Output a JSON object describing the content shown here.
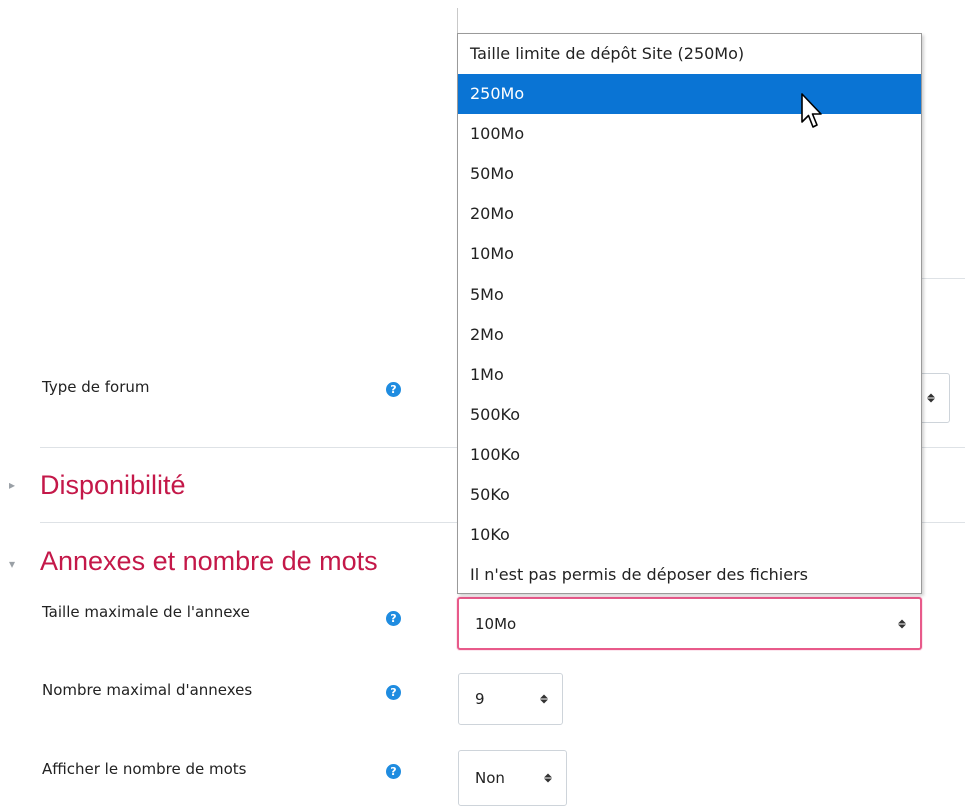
{
  "form": {
    "forum_type": {
      "label": "Type de forum"
    },
    "sections": {
      "disponibilite": "Disponibilité",
      "annexes": "Annexes et nombre de mots"
    },
    "max_attachment_size": {
      "label": "Taille maximale de l'annexe",
      "value": "10Mo"
    },
    "max_attachments": {
      "label": "Nombre maximal d'annexes",
      "value": "9"
    },
    "show_word_count": {
      "label": "Afficher le nombre de mots",
      "value": "Non"
    }
  },
  "dropdown": {
    "options": [
      "Taille limite de dépôt Site (250Mo)",
      "250Mo",
      "100Mo",
      "50Mo",
      "20Mo",
      "10Mo",
      "5Mo",
      "2Mo",
      "1Mo",
      "500Ko",
      "100Ko",
      "50Ko",
      "10Ko",
      "Il n'est pas permis de déposer des fichiers"
    ],
    "highlighted": "250Mo"
  },
  "icons": {
    "help": "question-circle-icon",
    "collapsed": "triangle-right-icon",
    "expanded": "triangle-down-icon",
    "cursor": "mouse-pointer-icon"
  },
  "colors": {
    "section_title": "#c41849",
    "help_icon": "#1f8ce0",
    "highlight": "#0a74d4",
    "focus_border": "#e85a8a"
  }
}
